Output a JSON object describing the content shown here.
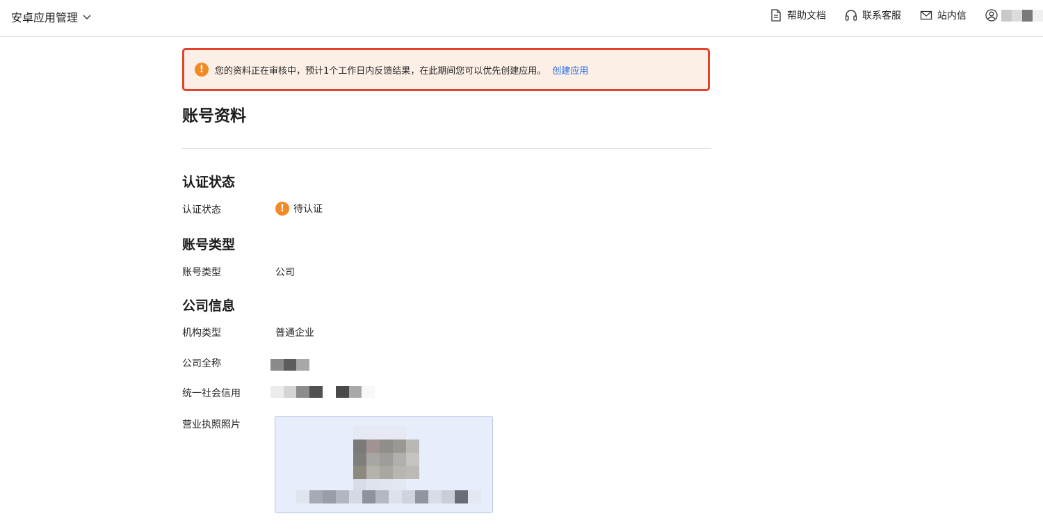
{
  "header": {
    "app_title": "安卓应用管理",
    "actions": [
      {
        "label": "帮助文档",
        "icon": "document-icon"
      },
      {
        "label": "联系客服",
        "icon": "headset-icon"
      },
      {
        "label": "站内信",
        "icon": "mail-icon"
      }
    ],
    "user_icon": "user-icon"
  },
  "alert": {
    "icon": "warning-icon",
    "message": "您的资料正在审核中，预计1个工作日内反馈结果，在此期间您可以优先创建应用。",
    "link": "创建应用",
    "colors": {
      "border": "#e5412c",
      "background": "#fcefe6",
      "link": "#1a66e0",
      "icon": "#f08a24"
    }
  },
  "page": {
    "title": "账号资料",
    "sections": {
      "verification": {
        "title": "认证状态",
        "status_label": "认证状态",
        "status_value": "待认证",
        "status_icon": "warning-icon"
      },
      "account_type": {
        "title": "账号类型",
        "label": "账号类型",
        "value": "公司"
      },
      "company": {
        "title": "公司信息",
        "org_type_label": "机构类型",
        "org_type_value": "普通企业",
        "full_name_label": "公司全称",
        "credit_code_label": "统一社会信用",
        "license_label": "营业执照照片"
      }
    }
  }
}
